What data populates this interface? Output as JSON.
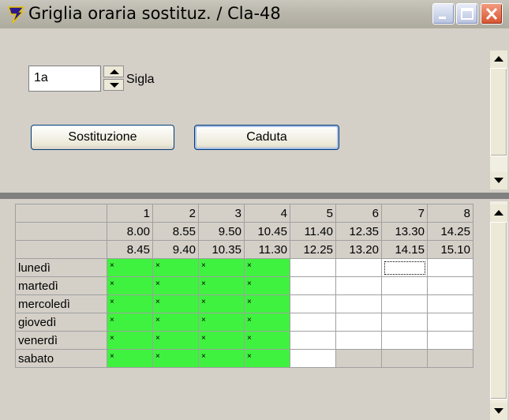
{
  "window": {
    "title": "Griglia oraria sostituz. / Cla-48"
  },
  "form": {
    "sigla_value": "1a",
    "sigla_label": "Sigla",
    "btn_sostituzione": "Sostituzione",
    "btn_caduta": "Caduta"
  },
  "grid": {
    "periods": [
      "1",
      "2",
      "3",
      "4",
      "5",
      "6",
      "7",
      "8"
    ],
    "start_times": [
      "8.00",
      "8.55",
      "9.50",
      "10.45",
      "11.40",
      "12.35",
      "13.30",
      "14.25"
    ],
    "end_times": [
      "8.45",
      "9.40",
      "10.35",
      "11.30",
      "12.25",
      "13.20",
      "14.15",
      "15.10"
    ],
    "days": [
      "lunedì",
      "martedì",
      "mercoledì",
      "giovedì",
      "venerdì",
      "sabato"
    ],
    "mark": "×",
    "colors": {
      "assigned": "#3ff23f",
      "free": "#ffffff",
      "unavailable": "#d4d0c8"
    }
  }
}
